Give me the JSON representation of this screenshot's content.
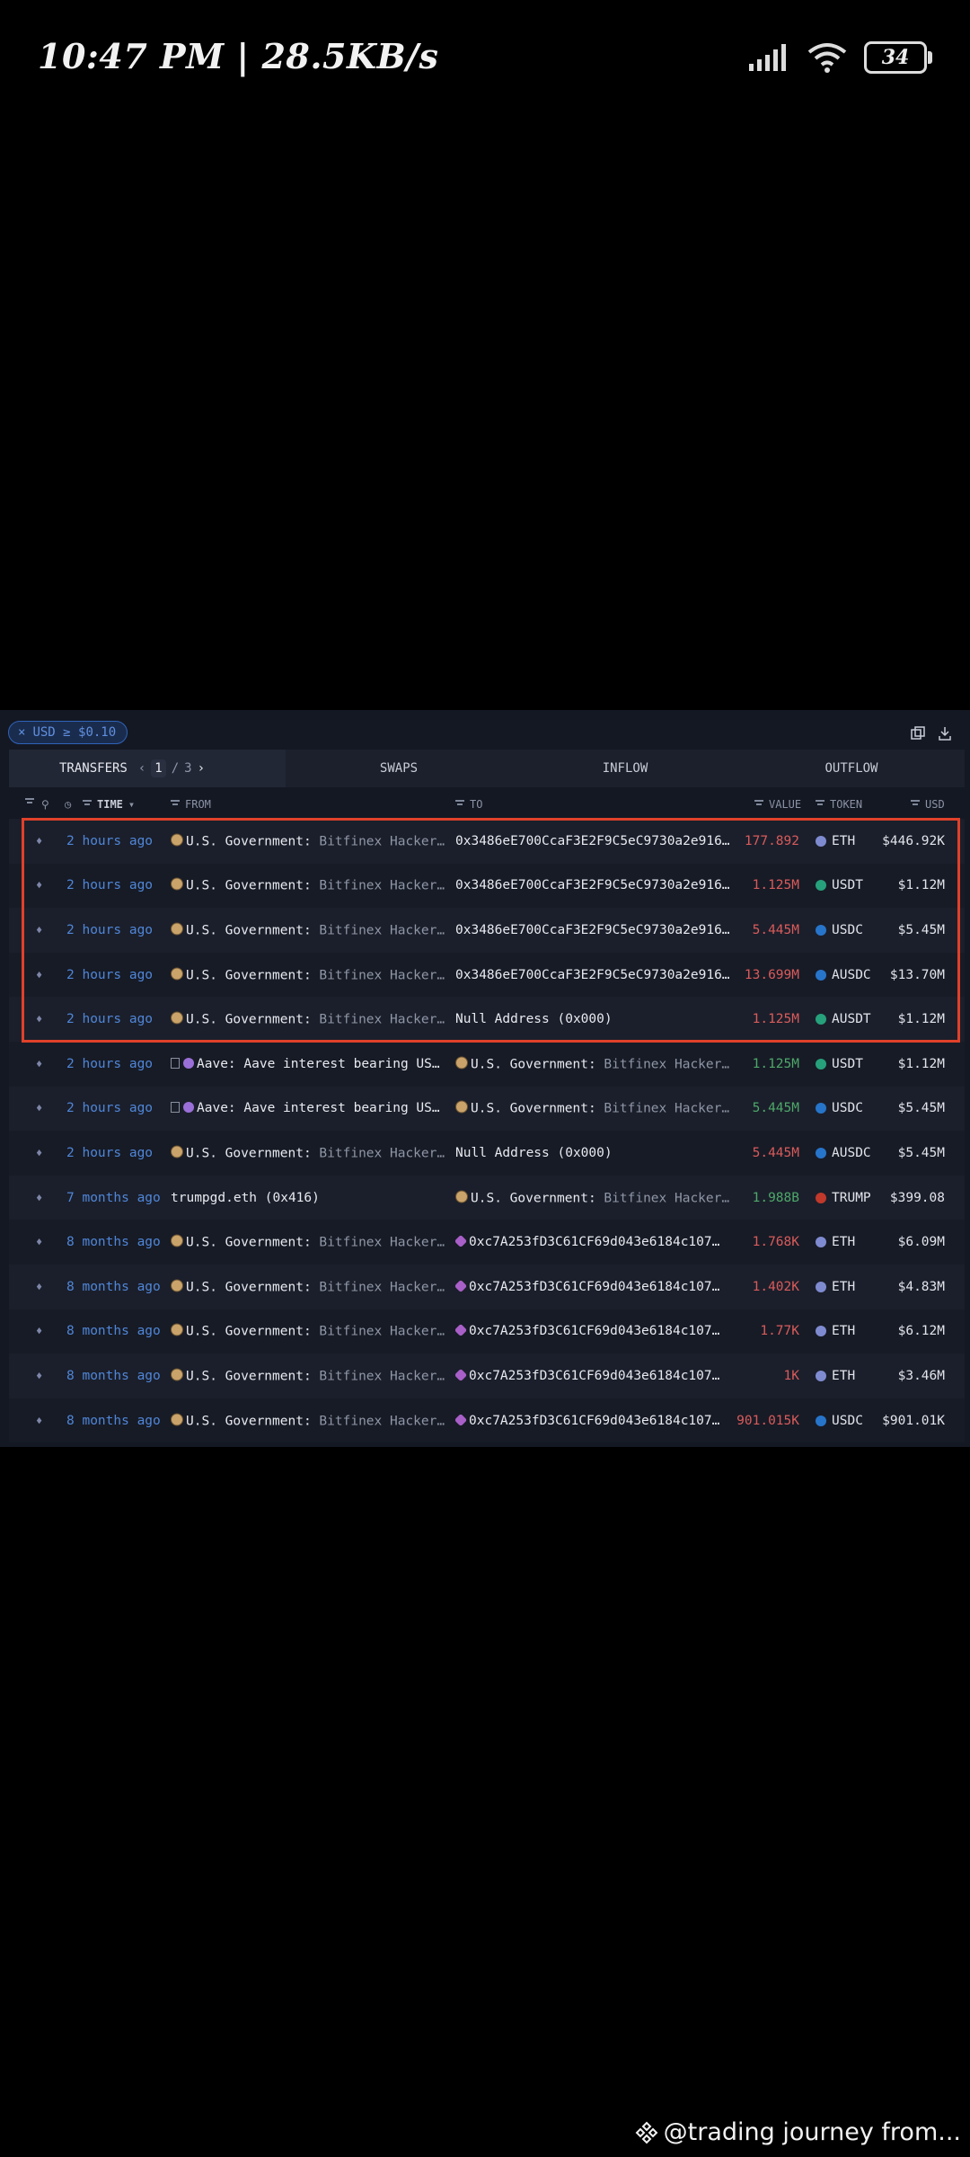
{
  "status_bar": {
    "time_text": "10:47 PM | 28.5KB/s",
    "battery": "34"
  },
  "filter_chip": {
    "label": "USD ≥ $0.10"
  },
  "tabs": {
    "transfers": "TRANSFERS",
    "page_current": "1",
    "page_sep": "/",
    "page_total": "3",
    "swaps": "SWAPS",
    "inflow": "INFLOW",
    "outflow": "OUTFLOW"
  },
  "columns": {
    "time": "TIME",
    "from": "FROM",
    "to": "TO",
    "value": "VALUE",
    "token": "TOKEN",
    "usd": "USD"
  },
  "colors": {
    "accent": "#4f86d8",
    "highlight": "#e0412a",
    "negative": "#d95b5b",
    "positive": "#4ea86a"
  },
  "rows": [
    {
      "time": "2 hours ago",
      "from_icon": "gov",
      "from_name": "U.S. Government:",
      "from_sub": "Bitfinex Hacker…",
      "to_icon": "",
      "to_name": "0x3486eE700CcaF3E2F9C5eC9730a2e916…",
      "to_sub": "",
      "value": "177.892",
      "value_sign": "neg",
      "token_icon": "eth",
      "token": "ETH",
      "usd": "$446.92K"
    },
    {
      "time": "2 hours ago",
      "from_icon": "gov",
      "from_name": "U.S. Government:",
      "from_sub": "Bitfinex Hacker…",
      "to_icon": "",
      "to_name": "0x3486eE700CcaF3E2F9C5eC9730a2e916…",
      "to_sub": "",
      "value": "1.125M",
      "value_sign": "neg",
      "token_icon": "usdt",
      "token": "USDT",
      "usd": "$1.12M"
    },
    {
      "time": "2 hours ago",
      "from_icon": "gov",
      "from_name": "U.S. Government:",
      "from_sub": "Bitfinex Hacker…",
      "to_icon": "",
      "to_name": "0x3486eE700CcaF3E2F9C5eC9730a2e916…",
      "to_sub": "",
      "value": "5.445M",
      "value_sign": "neg",
      "token_icon": "usdc",
      "token": "USDC",
      "usd": "$5.45M"
    },
    {
      "time": "2 hours ago",
      "from_icon": "gov",
      "from_name": "U.S. Government:",
      "from_sub": "Bitfinex Hacker…",
      "to_icon": "",
      "to_name": "0x3486eE700CcaF3E2F9C5eC9730a2e916…",
      "to_sub": "",
      "value": "13.699M",
      "value_sign": "neg",
      "token_icon": "usdc",
      "token": "AUSDC",
      "usd": "$13.70M"
    },
    {
      "time": "2 hours ago",
      "from_icon": "gov",
      "from_name": "U.S. Government:",
      "from_sub": "Bitfinex Hacker…",
      "to_icon": "",
      "to_name": "Null Address (0x000)",
      "to_sub": "",
      "value": "1.125M",
      "value_sign": "neg",
      "token_icon": "usdt",
      "token": "AUSDT",
      "usd": "$1.12M"
    },
    {
      "time": "2 hours ago",
      "from_icon": "aave",
      "from_name": "Aave: Aave interest bearing US…",
      "from_sub": "",
      "to_icon": "gov",
      "to_name": "U.S. Government:",
      "to_sub": "Bitfinex Hacker…",
      "value": "1.125M",
      "value_sign": "pos",
      "token_icon": "usdt",
      "token": "USDT",
      "usd": "$1.12M"
    },
    {
      "time": "2 hours ago",
      "from_icon": "aave",
      "from_name": "Aave: Aave interest bearing US…",
      "from_sub": "",
      "to_icon": "gov",
      "to_name": "U.S. Government:",
      "to_sub": "Bitfinex Hacker…",
      "value": "5.445M",
      "value_sign": "pos",
      "token_icon": "usdc",
      "token": "USDC",
      "usd": "$5.45M"
    },
    {
      "time": "2 hours ago",
      "from_icon": "gov",
      "from_name": "U.S. Government:",
      "from_sub": "Bitfinex Hacker…",
      "to_icon": "",
      "to_name": "Null Address (0x000)",
      "to_sub": "",
      "value": "5.445M",
      "value_sign": "neg",
      "token_icon": "usdc",
      "token": "AUSDC",
      "usd": "$5.45M"
    },
    {
      "time": "7 months ago",
      "from_icon": "",
      "from_name": "trumpgd.eth (0x416)",
      "from_sub": "",
      "to_icon": "gov",
      "to_name": "U.S. Government:",
      "to_sub": "Bitfinex Hacker…",
      "value": "1.988B",
      "value_sign": "pos",
      "token_icon": "trump",
      "token": "TRUMP",
      "usd": "$399.08"
    },
    {
      "time": "8 months ago",
      "from_icon": "gov",
      "from_name": "U.S. Government:",
      "from_sub": "Bitfinex Hacker…",
      "to_icon": "fox",
      "to_name": "0xc7A253fD3C61CF69d043e6184c107…",
      "to_sub": "",
      "value": "1.768K",
      "value_sign": "neg",
      "token_icon": "eth",
      "token": "ETH",
      "usd": "$6.09M"
    },
    {
      "time": "8 months ago",
      "from_icon": "gov",
      "from_name": "U.S. Government:",
      "from_sub": "Bitfinex Hacker…",
      "to_icon": "fox",
      "to_name": "0xc7A253fD3C61CF69d043e6184c107…",
      "to_sub": "",
      "value": "1.402K",
      "value_sign": "neg",
      "token_icon": "eth",
      "token": "ETH",
      "usd": "$4.83M"
    },
    {
      "time": "8 months ago",
      "from_icon": "gov",
      "from_name": "U.S. Government:",
      "from_sub": "Bitfinex Hacker…",
      "to_icon": "fox",
      "to_name": "0xc7A253fD3C61CF69d043e6184c107…",
      "to_sub": "",
      "value": "1.77K",
      "value_sign": "neg",
      "token_icon": "eth",
      "token": "ETH",
      "usd": "$6.12M"
    },
    {
      "time": "8 months ago",
      "from_icon": "gov",
      "from_name": "U.S. Government:",
      "from_sub": "Bitfinex Hacker…",
      "to_icon": "fox",
      "to_name": "0xc7A253fD3C61CF69d043e6184c107…",
      "to_sub": "",
      "value": "1K",
      "value_sign": "neg",
      "token_icon": "eth",
      "token": "ETH",
      "usd": "$3.46M"
    },
    {
      "time": "8 months ago",
      "from_icon": "gov",
      "from_name": "U.S. Government:",
      "from_sub": "Bitfinex Hacker…",
      "to_icon": "fox",
      "to_name": "0xc7A253fD3C61CF69d043e6184c107…",
      "to_sub": "",
      "value": "901.015K",
      "value_sign": "neg",
      "token_icon": "usdc",
      "token": "USDC",
      "usd": "$901.01K"
    }
  ],
  "watermark": {
    "text": "@trading journey from..."
  }
}
